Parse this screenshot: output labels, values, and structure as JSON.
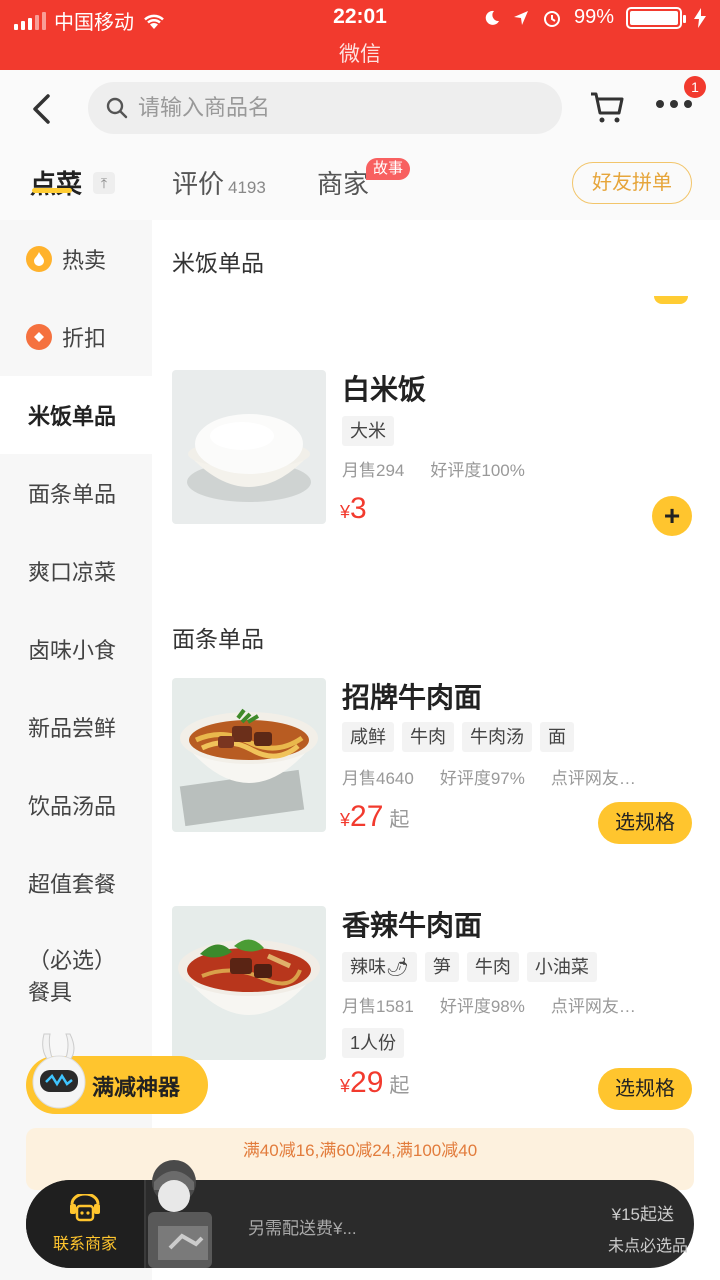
{
  "status_bar": {
    "carrier": "中国移动",
    "time": "22:01",
    "app": "微信",
    "battery": "99%",
    "battery_level": 0.99
  },
  "header": {
    "search_placeholder": "请输入商品名",
    "cart_badge": "1"
  },
  "tabs": [
    {
      "label": "点菜"
    },
    {
      "label": "评价",
      "count": "4193"
    },
    {
      "label": "商家",
      "badge": "故事"
    }
  ],
  "friend_button": "好友拼单",
  "sidebar": [
    {
      "label": "热卖",
      "icon": "fire-icon"
    },
    {
      "label": "折扣",
      "icon": "discount-icon"
    },
    {
      "label": "米饭单品",
      "active": true
    },
    {
      "label": "面条单品"
    },
    {
      "label": "爽口凉菜"
    },
    {
      "label": "卤味小食"
    },
    {
      "label": "新品尝鲜"
    },
    {
      "label": "饮品汤品"
    },
    {
      "label": "超值套餐"
    },
    {
      "label": "（必选）餐具"
    }
  ],
  "sections": {
    "rice": "米饭单品",
    "noodles": "面条单品"
  },
  "dishes": [
    {
      "name": "白米饭",
      "tags": [
        "大米"
      ],
      "sales": "月售294",
      "rating": "好评度100%",
      "price": "3",
      "currency": "¥"
    },
    {
      "name": "招牌牛肉面",
      "tags": [
        "咸鲜",
        "牛肉",
        "牛肉汤",
        "面"
      ],
      "sales": "月售4640",
      "rating": "好评度97%",
      "extra": "点评网友…",
      "price": "27",
      "currency": "¥",
      "suffix": "起",
      "button": "选规格"
    },
    {
      "name": "香辣牛肉面",
      "tags": [
        "辣味🌶",
        "笋",
        "牛肉",
        "小油菜"
      ],
      "sales": "月售1581",
      "rating": "好评度98%",
      "extra": "点评网友…",
      "serving": "1人份",
      "price": "29",
      "currency": "¥",
      "suffix": "起",
      "button": "选规格"
    }
  ],
  "floating": {
    "manjian": "满减神器"
  },
  "promo": {
    "text": "满40减16,满60减24,满100减40"
  },
  "cart_bar": {
    "contact": "联系商家",
    "note": "另需配送费¥...",
    "min_order": "¥15起送",
    "unselected": "未点必选品"
  },
  "colors": {
    "brand_red": "#f23a2e",
    "accent_yellow": "#ffc52e",
    "price_red": "#f23a2e"
  }
}
